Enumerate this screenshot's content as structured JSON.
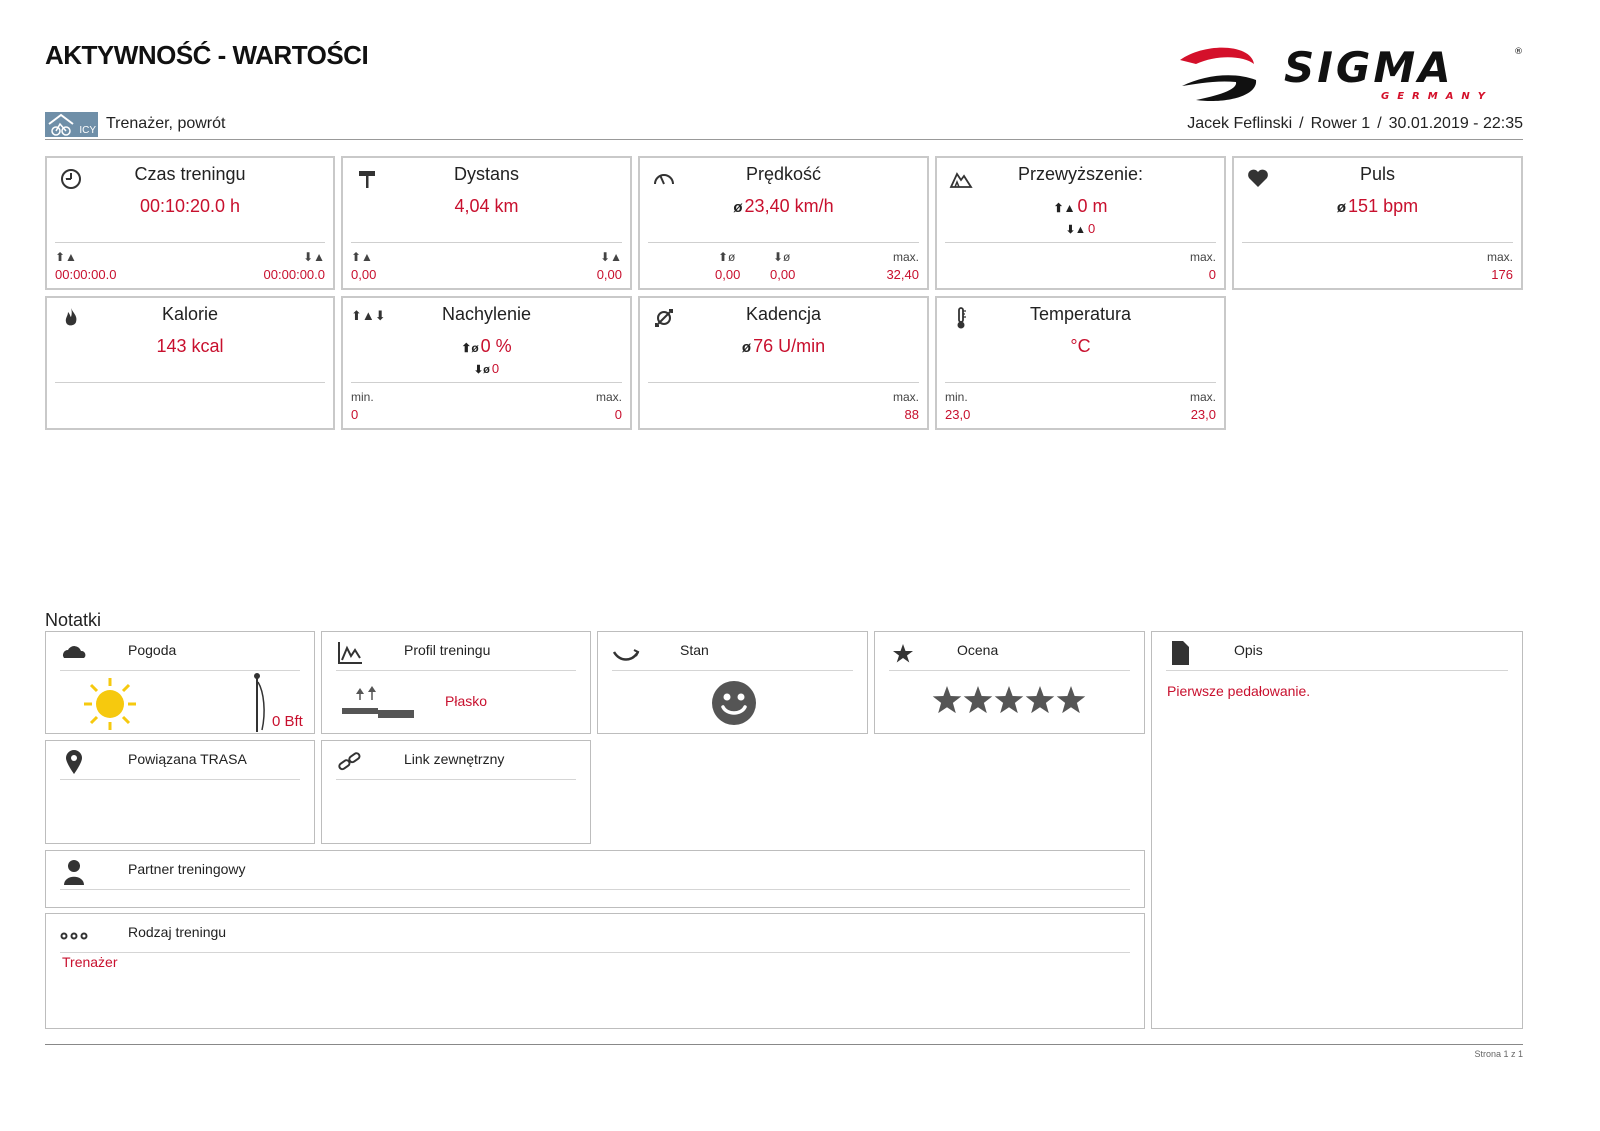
{
  "header": {
    "title": "AKTYWNOŚĆ - WARTOŚCI",
    "logo_text": "SIGMA",
    "logo_sub": "GERMANY",
    "registered_mark": "®",
    "sport_badge": "ICY",
    "sport_label": "Trenażer, powrót",
    "user": "Jacek Feflinski",
    "bike": "Rower 1",
    "datetime": "30.01.2019 - 22:35",
    "separator": "/"
  },
  "stats": {
    "time": {
      "title": "Czas treningu",
      "value": "00:10:20.0 h",
      "up": "00:00:00.0",
      "down": "00:00:00.0"
    },
    "distance": {
      "title": "Dystans",
      "value": "4,04 km",
      "up": "0,00",
      "down": "0,00"
    },
    "speed": {
      "title": "Prędkość",
      "avg_symbol": "ø",
      "value": "23,40 km/h",
      "up_avg": "0,00",
      "down_avg": "0,00",
      "max_label": "max.",
      "max": "32,40"
    },
    "altitude": {
      "title": "Przewyższenie:",
      "up": "0 m",
      "down": "0",
      "max_label": "max.",
      "max": "0"
    },
    "pulse": {
      "title": "Puls",
      "avg_symbol": "ø",
      "value": "151 bpm",
      "max_label": "max.",
      "max": "176"
    },
    "calories": {
      "title": "Kalorie",
      "value": "143 kcal"
    },
    "incline": {
      "title": "Nachylenie",
      "up_avg": "0 %",
      "down_avg": "0",
      "min_label": "min.",
      "min": "0",
      "max_label": "max.",
      "max": "0"
    },
    "cadence": {
      "title": "Kadencja",
      "avg_symbol": "ø",
      "value": "76 U/min",
      "max_label": "max.",
      "max": "88"
    },
    "temperature": {
      "title": "Temperatura",
      "value": "°C",
      "min_label": "min.",
      "min": "23,0",
      "max_label": "max.",
      "max": "23,0"
    }
  },
  "notes": {
    "title": "Notatki",
    "weather": {
      "title": "Pogoda",
      "wind": "0 Bft"
    },
    "profile": {
      "title": "Profil treningu",
      "value": "Płasko"
    },
    "condition": {
      "title": "Stan"
    },
    "rating": {
      "title": "Ocena",
      "stars": 5,
      "max_stars": 5
    },
    "description": {
      "title": "Opis",
      "text": "Pierwsze pedałowanie."
    },
    "route": {
      "title": "Powiązana TRASA"
    },
    "link": {
      "title": "Link zewnętrzny"
    },
    "partner": {
      "title": "Partner treningowy"
    },
    "training_type": {
      "title": "Rodzaj treningu",
      "value": "Trenażer"
    }
  },
  "footer": {
    "page": "Strona 1 z 1"
  },
  "colors": {
    "accent": "#c8102e",
    "border": "#c9c9c9",
    "icon": "#333333",
    "sun": "#f6c90e"
  }
}
